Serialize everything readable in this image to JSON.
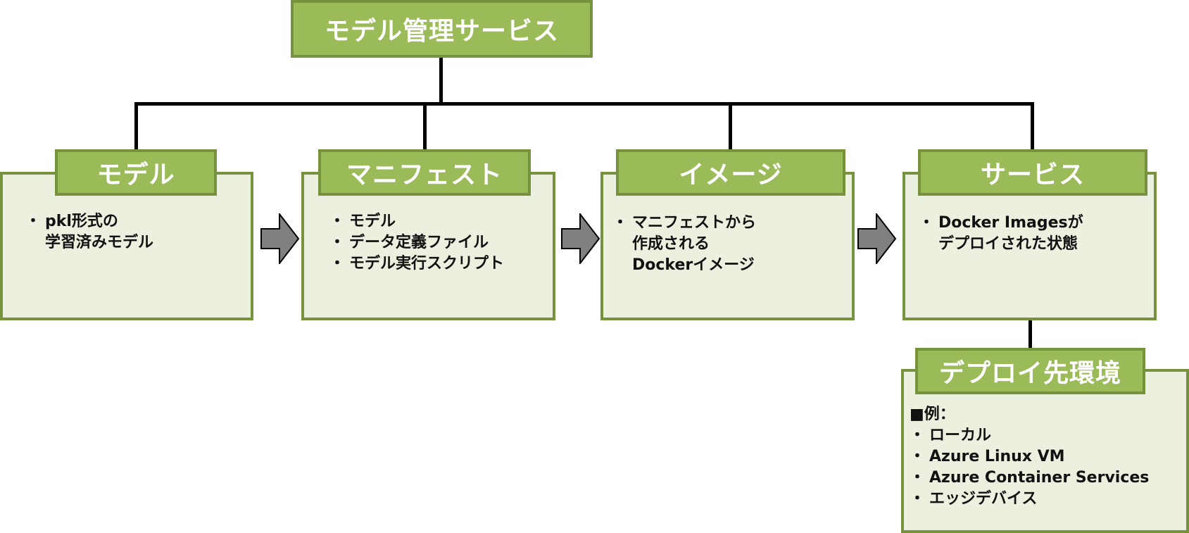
{
  "root": {
    "title": "モデル管理サービス"
  },
  "stages": [
    {
      "title": "モデル",
      "lines": [
        {
          "bullet": true,
          "text": "pkl形式の"
        },
        {
          "bullet": false,
          "text": "学習済みモデル"
        }
      ]
    },
    {
      "title": "マニフェスト",
      "lines": [
        {
          "bullet": true,
          "text": "モデル"
        },
        {
          "bullet": true,
          "text": "データ定義ファイル"
        },
        {
          "bullet": true,
          "text": "モデル実行スクリプト"
        }
      ]
    },
    {
      "title": "イメージ",
      "lines": [
        {
          "bullet": true,
          "text": "マニフェストから"
        },
        {
          "bullet": false,
          "text": "作成される"
        },
        {
          "bullet": false,
          "text": "Dockerイメージ"
        }
      ]
    },
    {
      "title": "サービス",
      "lines": [
        {
          "bullet": true,
          "text": "Docker Imagesが"
        },
        {
          "bullet": false,
          "text": "デプロイされた状態"
        }
      ]
    }
  ],
  "deploy": {
    "title": "デプロイ先環境",
    "heading": "■例：",
    "items": [
      "ローカル",
      "Azure Linux VM",
      "Azure Container Services",
      "エッジデバイス"
    ]
  },
  "bullet_char": "・",
  "colors": {
    "header_fill": "#9bbb59",
    "header_border": "#76923c",
    "body_fill": "#ebf1de",
    "arrow_fill": "#808080"
  }
}
